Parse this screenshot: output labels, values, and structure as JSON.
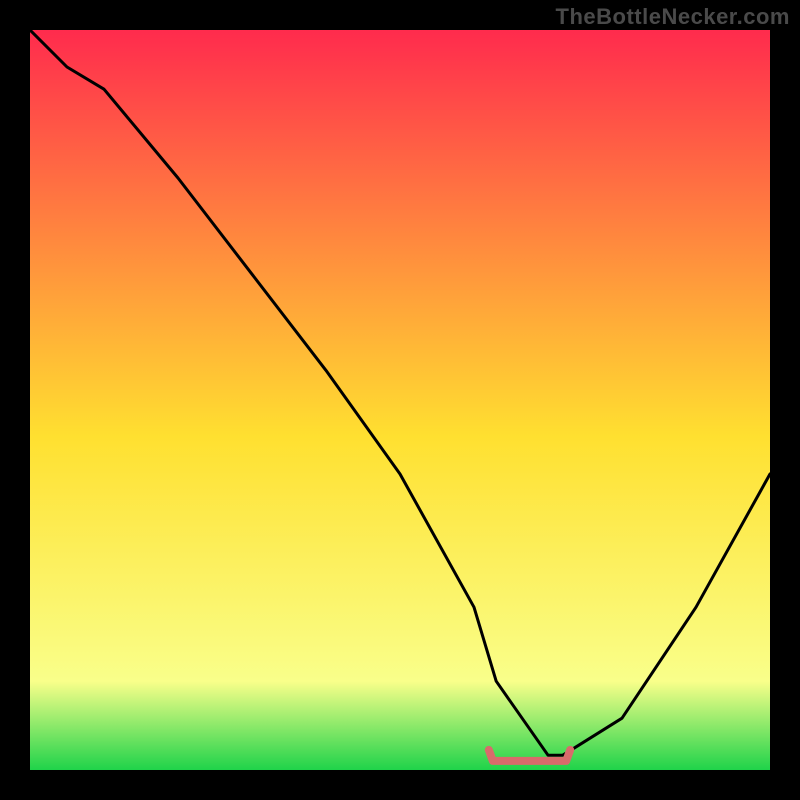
{
  "watermark": "TheBottleNecker.com",
  "chart_data": {
    "type": "line",
    "title": "",
    "xlabel": "",
    "ylabel": "",
    "xlim": [
      0,
      100
    ],
    "ylim": [
      0,
      100
    ],
    "background_gradient": {
      "top": "#ff2b4d",
      "mid": "#ffe030",
      "bottom": "#1fd34a"
    },
    "series": [
      {
        "name": "bottleneck-curve",
        "color": "#000000",
        "x": [
          0,
          5,
          10,
          20,
          30,
          40,
          50,
          60,
          63,
          70,
          72,
          80,
          90,
          100
        ],
        "values": [
          100,
          95,
          92,
          80,
          67,
          54,
          40,
          22,
          12,
          2,
          2,
          7,
          22,
          40
        ]
      }
    ],
    "marker": {
      "name": "optimal-range",
      "color": "#d96b6b",
      "x_start": 62,
      "x_end": 73,
      "y": 1.5
    }
  }
}
